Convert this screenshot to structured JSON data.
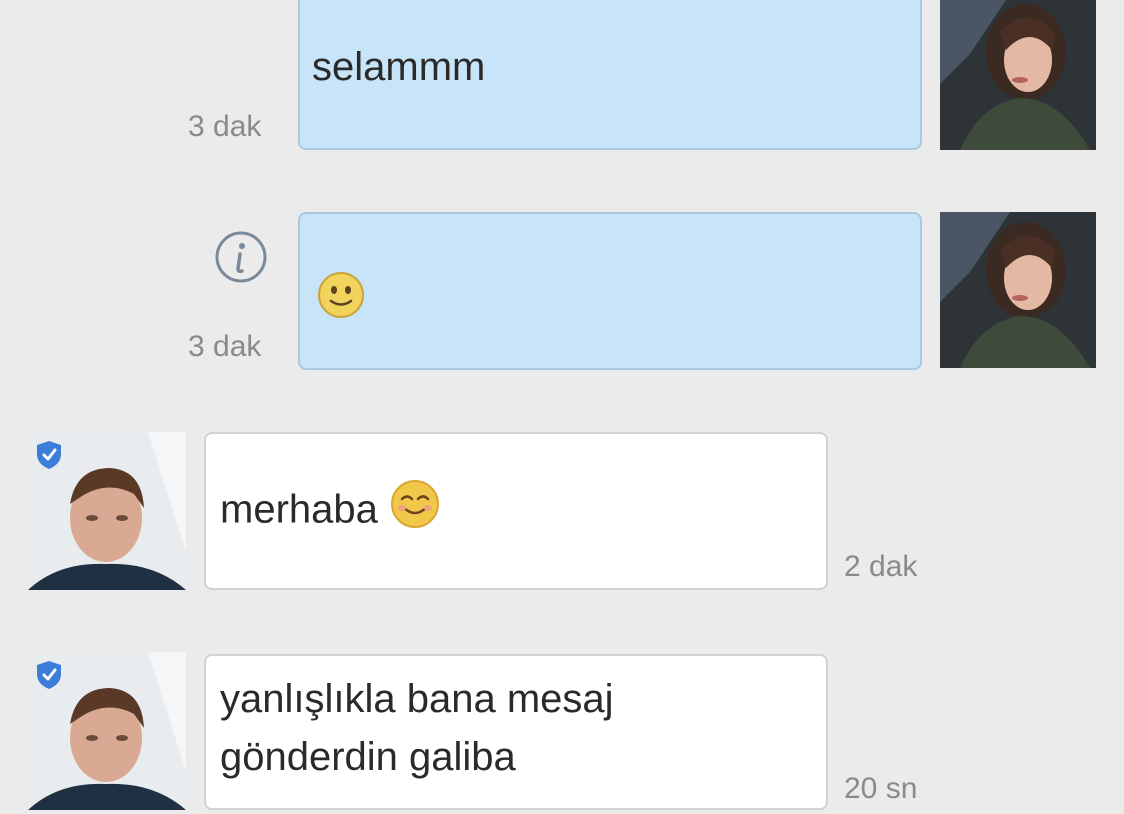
{
  "messages": [
    {
      "direction": "outgoing",
      "text": "selammm",
      "time": "3 dak",
      "has_info_icon": false,
      "avatar": "female-user-avatar"
    },
    {
      "direction": "outgoing",
      "emoji": "slightly-smiling-face-emoji",
      "time": "3 dak",
      "has_info_icon": true,
      "avatar": "female-user-avatar"
    },
    {
      "direction": "incoming",
      "text": "merhaba",
      "emoji": "smiling-face-emoji",
      "time": "2 dak",
      "verified": true,
      "avatar": "male-user-avatar"
    },
    {
      "direction": "incoming",
      "text_lines": [
        "yanlışlıkla bana mesaj",
        "gönderdin galiba"
      ],
      "time": "20 sn",
      "verified": true,
      "avatar": "male-user-avatar"
    }
  ],
  "colors": {
    "background": "#ebebeb",
    "outgoing_bubble": "#c8e4f8",
    "incoming_bubble": "#ffffff",
    "timestamp": "#8a8a8a",
    "verified_badge": "#3b7dd8"
  }
}
